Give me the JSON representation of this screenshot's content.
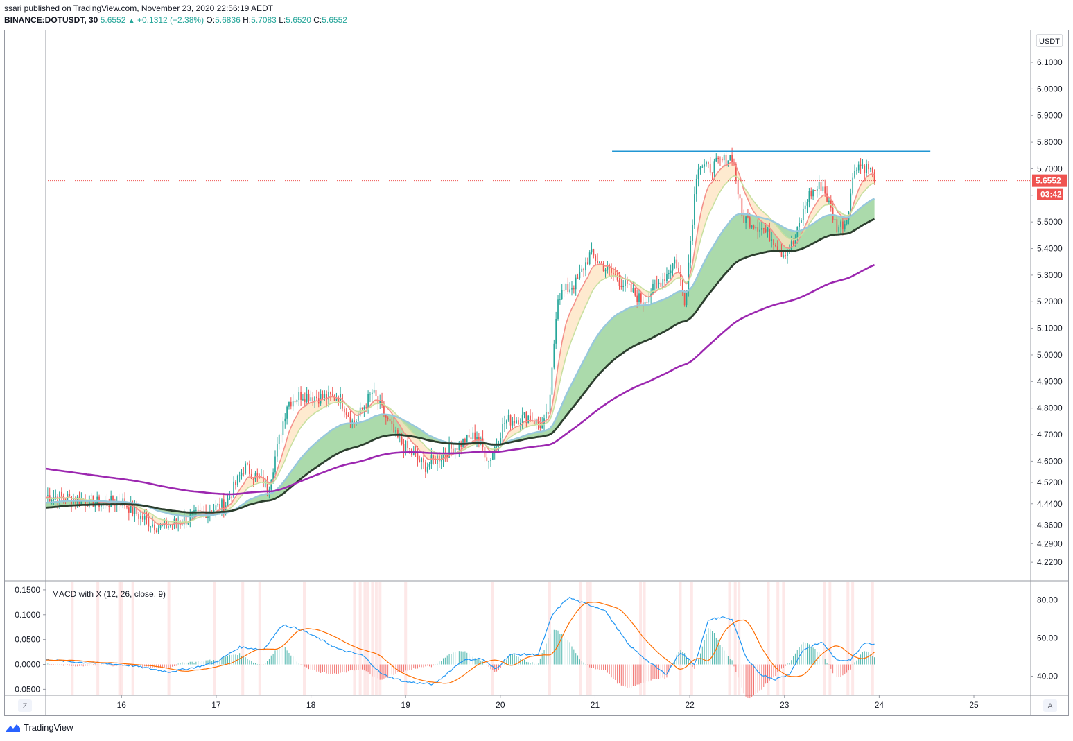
{
  "header": {
    "publisher_line": "ssari published on TradingView.com, November 23, 2020 22:56:19 AEDT",
    "symbol": "BINANCE:DOTUSDT, 30",
    "last": "5.6552",
    "change": "+0.1312 (+2.38%)",
    "o_label": "O:",
    "o_val": "5.6836",
    "h_label": "H:",
    "h_val": "5.7083",
    "l_label": "L:",
    "l_val": "5.6520",
    "c_label": "C:",
    "c_val": "5.6552"
  },
  "footer": {
    "brand": "TradingView"
  },
  "chart_data": [
    {
      "type": "line",
      "title": "BINANCE:DOTUSDT, 30",
      "currency_label": "USDT",
      "y_ticks": [
        "6.1000",
        "6.0000",
        "5.9000",
        "5.8000",
        "5.7000",
        "5.6000",
        "5.5000",
        "5.4000",
        "5.3000",
        "5.2000",
        "5.1000",
        "5.0000",
        "4.9000",
        "4.8000",
        "4.7000",
        "4.6000",
        "4.5200",
        "4.4400",
        "4.3600",
        "4.2900",
        "4.2200"
      ],
      "x_ticks": [
        "16",
        "17",
        "18",
        "19",
        "20",
        "21",
        "22",
        "23",
        "24",
        "25"
      ],
      "x_ticks_num": [
        16,
        17,
        18,
        19,
        20,
        21,
        22,
        23,
        24,
        25
      ],
      "xlim": [
        15.2,
        25.6
      ],
      "ylim": [
        4.15,
        6.22
      ],
      "last_price_label": "5.6552",
      "countdown_label": "03:42",
      "last_price": 5.6552,
      "resistance_line": {
        "x_start": 21.18,
        "x_end": 24.54,
        "y": 5.765
      },
      "close_anchors": {
        "x": [
          15.2,
          15.5,
          15.8,
          16.0,
          16.2,
          16.4,
          16.6,
          16.9,
          17.1,
          17.3,
          17.55,
          17.75,
          17.9,
          18.1,
          18.3,
          18.45,
          18.65,
          18.9,
          19.2,
          19.5,
          19.75,
          19.88,
          20.05,
          20.3,
          20.45,
          20.52,
          20.6,
          20.8,
          20.95,
          21.1,
          21.35,
          21.5,
          21.75,
          21.85,
          21.95,
          22.08,
          22.2,
          22.45,
          22.55,
          22.75,
          22.9,
          22.98,
          23.1,
          23.25,
          23.4,
          23.55,
          23.65,
          23.75,
          23.9,
          23.95
        ],
        "y": [
          4.47,
          4.46,
          4.44,
          4.45,
          4.39,
          4.35,
          4.37,
          4.41,
          4.44,
          4.58,
          4.5,
          4.82,
          4.85,
          4.84,
          4.84,
          4.74,
          4.86,
          4.69,
          4.58,
          4.65,
          4.7,
          4.6,
          4.75,
          4.77,
          4.73,
          4.8,
          5.22,
          5.27,
          5.38,
          5.33,
          5.25,
          5.2,
          5.3,
          5.36,
          5.2,
          5.72,
          5.7,
          5.75,
          5.52,
          5.48,
          5.43,
          5.38,
          5.42,
          5.6,
          5.64,
          5.48,
          5.5,
          5.72,
          5.7,
          5.6552
        ]
      },
      "ma_series": [
        {
          "color": "#f4908a",
          "length": 10
        },
        {
          "color": "#c8e0a0",
          "length": 20
        },
        {
          "color": "#98c8dc",
          "length": 50
        },
        {
          "color": "#2c3e2e",
          "length": 100
        },
        {
          "color": "#9c27b0",
          "length": 200
        }
      ],
      "fill_colors": {
        "fast": "#fde3bf",
        "slow": "#8fce8f"
      },
      "candle_colors": {
        "up": "#26a69a",
        "down": "#ef5350"
      }
    },
    {
      "type": "line",
      "title": "MACD with X (12, 26, close, 9)",
      "y_ticks_left": [
        "0.1500",
        "0.1000",
        "0.0500",
        "0.0000",
        "-0.0500"
      ],
      "y_ticks_left_num": [
        0.15,
        0.1,
        0.05,
        0.0,
        -0.05
      ],
      "y_ticks_right": [
        "80.00",
        "60.00",
        "40.00"
      ],
      "y_ticks_right_num": [
        80,
        60,
        40
      ],
      "ylim_left": [
        -0.062,
        0.168
      ],
      "ylim_right": [
        30,
        90
      ],
      "series": [
        {
          "color": "#2196f3"
        },
        {
          "color": "#ff6d00"
        }
      ],
      "histogram_colors": {
        "up": "#26a69a",
        "down": "#ef5350"
      },
      "macd_anchors": {
        "x": [
          15.2,
          15.5,
          15.8,
          16.1,
          16.5,
          16.8,
          17.0,
          17.25,
          17.5,
          17.7,
          17.9,
          18.3,
          18.55,
          18.75,
          19.0,
          19.3,
          19.6,
          19.8,
          19.95,
          20.1,
          20.4,
          20.55,
          20.72,
          20.85,
          21.1,
          21.35,
          21.6,
          21.75,
          21.9,
          22.05,
          22.2,
          22.35,
          22.45,
          22.6,
          22.75,
          22.9,
          23.05,
          23.2,
          23.4,
          23.55,
          23.7,
          23.85,
          23.95
        ],
        "y": [
          0.01,
          0.005,
          0.002,
          -0.002,
          -0.015,
          -0.005,
          0.005,
          0.035,
          0.03,
          0.08,
          0.07,
          0.03,
          0.018,
          -0.02,
          -0.035,
          -0.04,
          0.008,
          0.012,
          -0.01,
          0.02,
          0.02,
          0.1,
          0.135,
          0.125,
          0.11,
          0.04,
          0.0,
          -0.02,
          0.025,
          0.0,
          0.09,
          0.095,
          0.09,
          0.01,
          -0.02,
          -0.03,
          -0.02,
          0.03,
          0.045,
          0.008,
          0.01,
          0.045,
          0.04
        ]
      },
      "highlight_days": [
        15.48,
        15.75,
        15.98,
        16.0,
        16.12,
        16.5,
        16.98,
        17.28,
        17.46,
        17.93,
        18.46,
        18.52,
        18.57,
        18.6,
        18.65,
        18.69,
        18.73,
        19.0,
        19.92,
        20.52,
        20.85,
        20.92,
        20.95,
        21.48,
        21.52,
        21.9,
        22.02,
        22.42,
        22.48,
        22.52,
        22.83,
        22.93,
        22.99,
        23.42,
        23.48,
        23.67,
        23.72,
        23.93
      ]
    }
  ]
}
